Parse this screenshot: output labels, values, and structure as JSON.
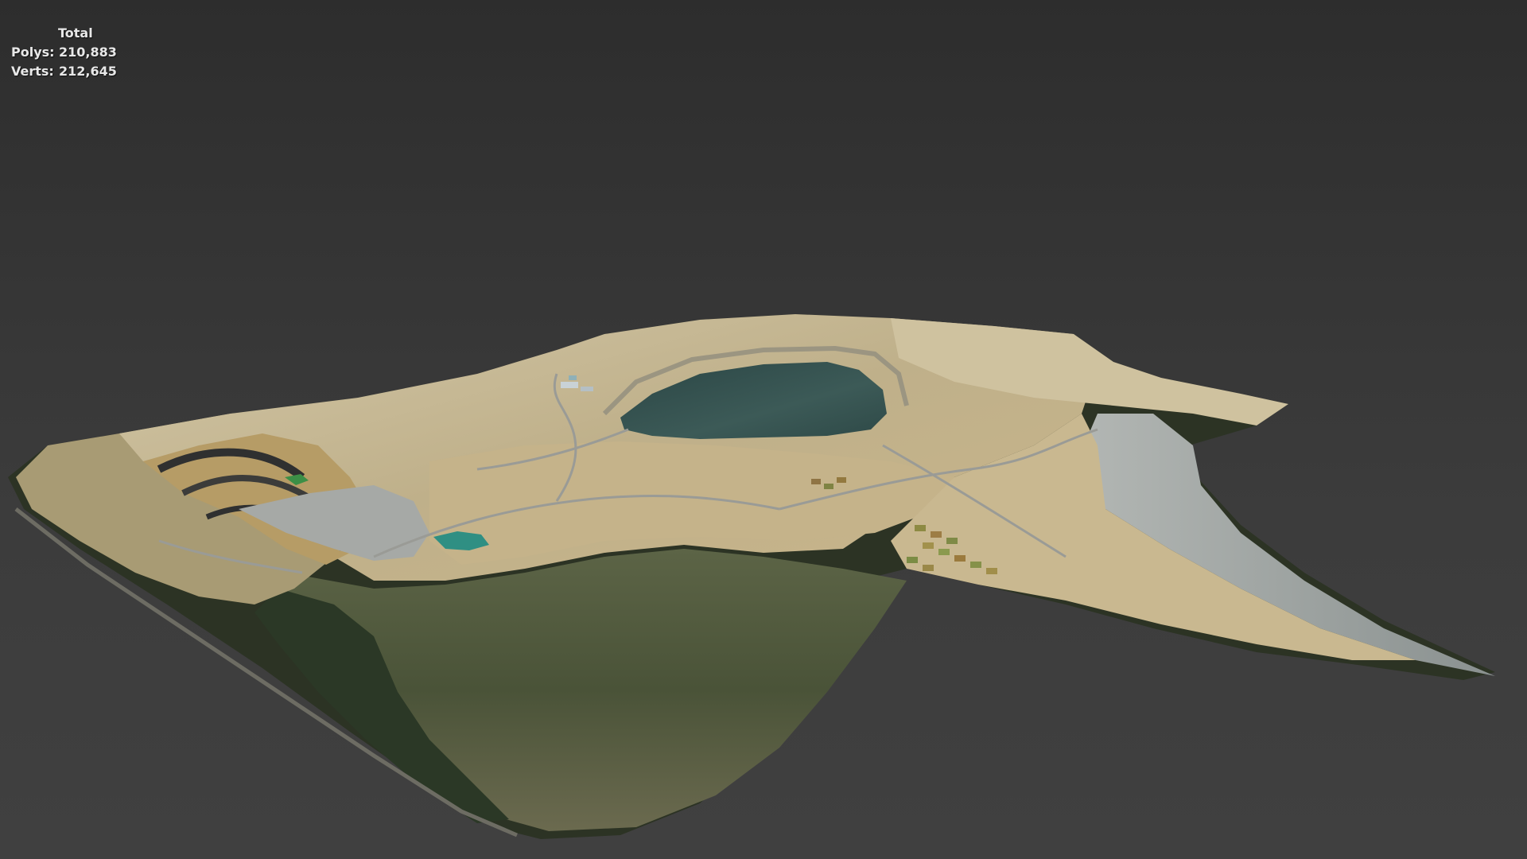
{
  "stats": {
    "title": "Total",
    "polys_label": "Polys:",
    "polys_value": "210,883",
    "verts_label": "Verts:",
    "verts_value": "212,645"
  },
  "colors": {
    "background_top": "#2d2d2d",
    "background_bottom": "#404040",
    "terrain_light": "#c9bb98",
    "terrain_tan": "#b9a06a",
    "terrain_gray": "#9ea3a2",
    "vegetation": "#4b5a39",
    "forest_dark": "#2f3b27",
    "lake_water": "#344e4c",
    "teal_pond": "#2f8f83",
    "green_pond": "#3c8f46"
  }
}
